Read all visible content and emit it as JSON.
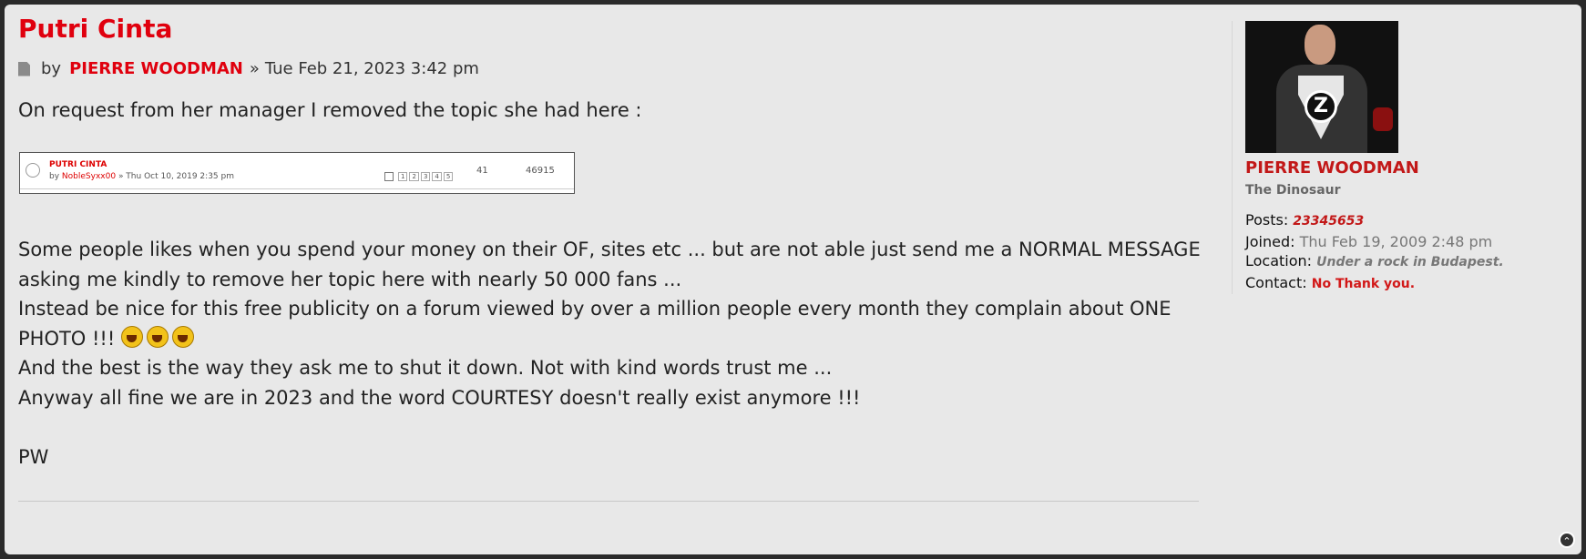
{
  "post": {
    "title": "Putri Cinta",
    "by": "by",
    "author": "PIERRE WOODMAN",
    "separator": "»",
    "date": "Tue Feb 21, 2023 3:42 pm",
    "intro": "On request from her manager I removed the topic she had here :",
    "lines": [
      "Some people likes when you spend your money on their OF, sites etc ... but are not able just send me a NORMAL MESSAGE",
      "asking me kindly to remove her topic here with nearly 50 000 fans ...",
      "Instead be nice for this free publicity on a forum viewed by over a million people every month they complain about ONE",
      "PHOTO !!!",
      "And the best is the way they ask me to shut it down. Not with kind words trust me ...",
      "Anyway all fine we are in 2023 and the word COURTESY doesn't really exist anymore !!!"
    ],
    "signoff": "PW"
  },
  "thumbnail": {
    "title": "PUTRI CINTA",
    "by": "by",
    "author": "NobleSyxx00",
    "date": "» Thu Oct 10, 2019 2:35 pm",
    "pages": [
      "1",
      "2",
      "3",
      "4",
      "5"
    ],
    "replies": "41",
    "views": "46915"
  },
  "profile": {
    "name": "PIERRE WOODMAN",
    "rank": "The Dinosaur",
    "posts_label": "Posts:",
    "posts": "23345653",
    "joined_label": "Joined:",
    "joined": "Thu Feb 19, 2009 2:48 pm",
    "location_label": "Location:",
    "location": "Under a rock in Budapest.",
    "contact_label": "Contact:",
    "contact": "No Thank you."
  },
  "icons": {
    "post": "document-icon",
    "emoji": "laughing-emoji-icon",
    "top": "back-to-top-icon"
  },
  "colors": {
    "accent": "#e0000e",
    "background": "#e8e8e8"
  }
}
